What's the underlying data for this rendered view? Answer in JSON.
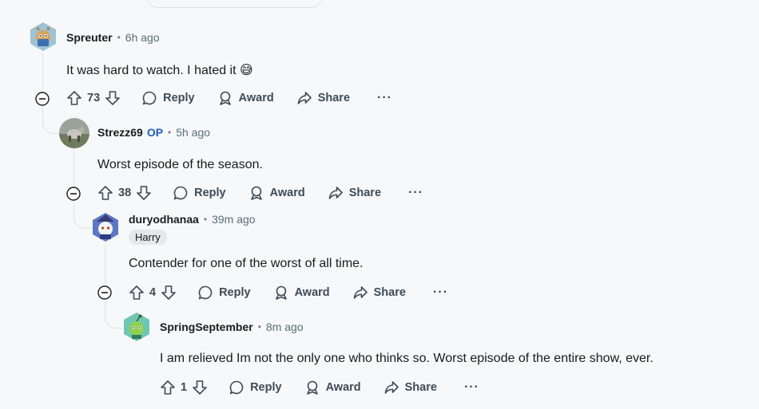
{
  "comments": [
    {
      "username": "Spreuter",
      "time": "6h ago",
      "body": "It was hard to watch. I hated it",
      "emoji": "😅",
      "score": "73",
      "reply": "Reply",
      "award": "Award",
      "share": "Share",
      "more": "···"
    },
    {
      "username": "Strezz69",
      "op": "OP",
      "time": "5h ago",
      "body": "Worst episode of the season.",
      "score": "38",
      "reply": "Reply",
      "award": "Award",
      "share": "Share",
      "more": "···"
    },
    {
      "username": "duryodhanaa",
      "time": "39m ago",
      "flair": "Harry",
      "body": "Contender for one of the worst of all time.",
      "score": "4",
      "reply": "Reply",
      "award": "Award",
      "share": "Share",
      "more": "···"
    },
    {
      "username": "SpringSeptember",
      "time": "8m ago",
      "body": "I am relieved Im not the only one who thinks so. Worst episode of the entire show, ever.",
      "score": "1",
      "reply": "Reply",
      "award": "Award",
      "share": "Share",
      "more": "···"
    }
  ],
  "separator": "•",
  "colors": {
    "op": "#1d5ec7",
    "action_text": "#3d4b55",
    "thread_line": "#dfe2e6"
  }
}
